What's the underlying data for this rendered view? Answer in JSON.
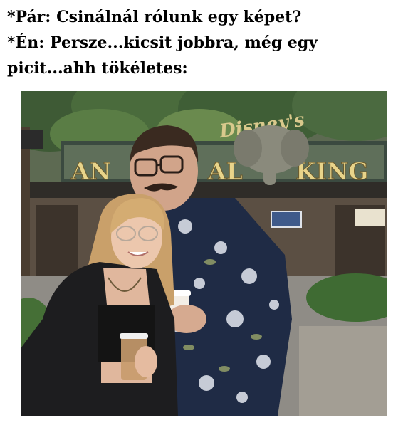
{
  "caption": {
    "line1": "*Pár: Csinálnál rólunk egy képet?",
    "line2": "*Én: Persze...kicsit jobbra, még egy",
    "line3": "picit...ahh tökéletes:"
  },
  "photo": {
    "sign": {
      "brand": "Disney's",
      "word_left": "AN",
      "word_mid": "AL",
      "word_right": "KING"
    }
  }
}
